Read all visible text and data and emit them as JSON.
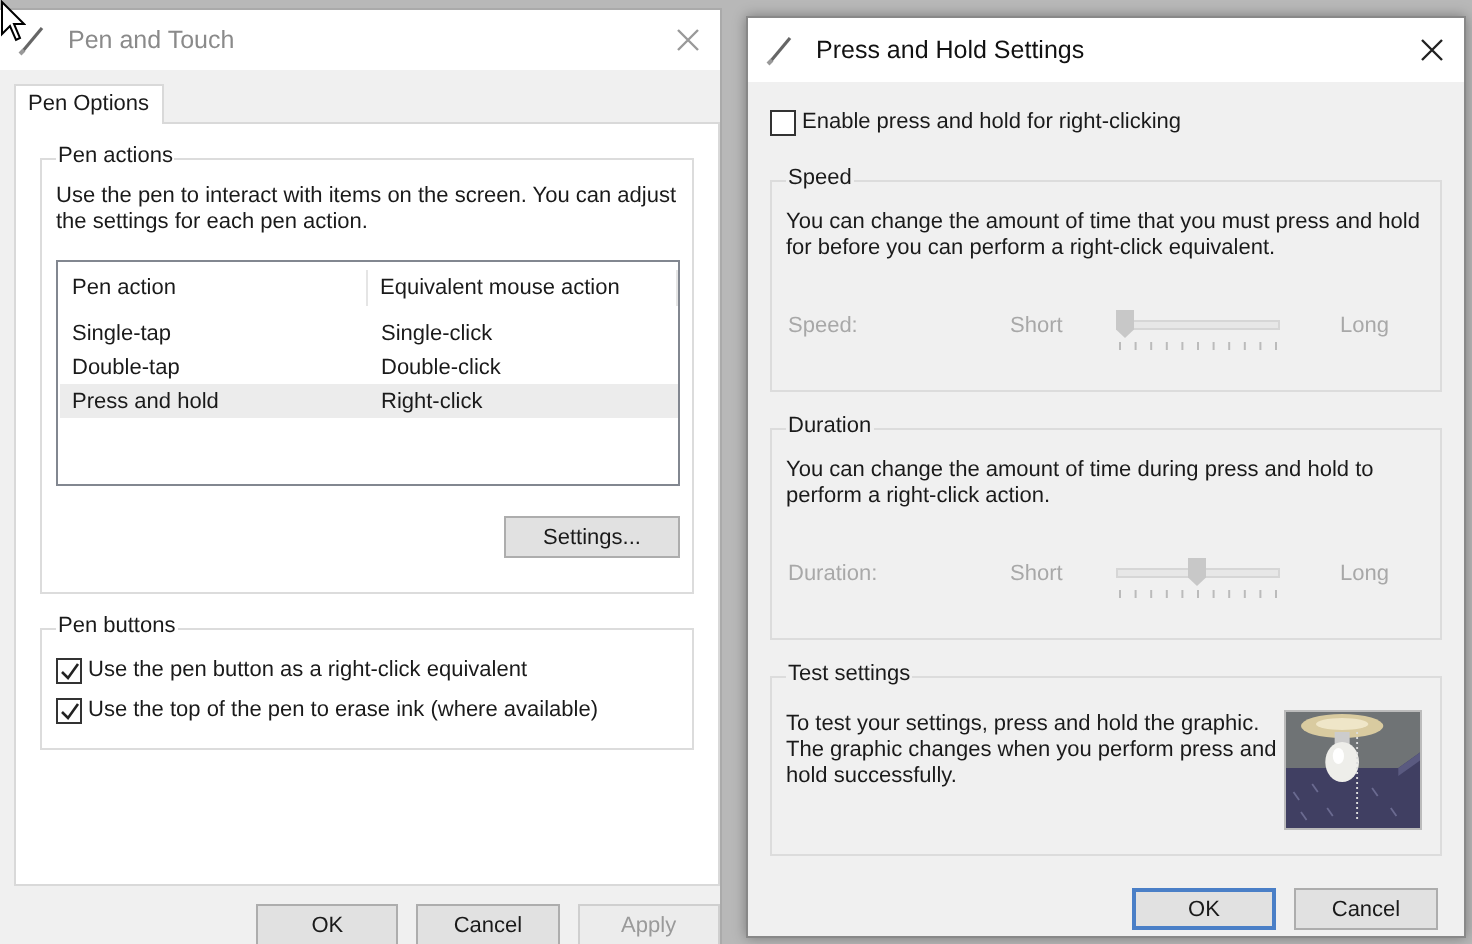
{
  "pen_and_touch": {
    "title": "Pen and Touch",
    "active": false,
    "tabs": [
      {
        "label": "Pen Options",
        "selected": true
      }
    ],
    "pen_actions": {
      "title": "Pen actions",
      "description": "Use the pen to interact with items on the screen. You can adjust the settings for each pen action.",
      "table": {
        "columns": [
          "Pen action",
          "Equivalent mouse action"
        ],
        "rows": [
          {
            "cells": [
              "Single-tap",
              "Single-click"
            ],
            "selected": false
          },
          {
            "cells": [
              "Double-tap",
              "Double-click"
            ],
            "selected": false
          },
          {
            "cells": [
              "Press and hold",
              "Right-click"
            ],
            "selected": true
          }
        ]
      },
      "button": "Settings..."
    },
    "pen_buttons": {
      "title": "Pen buttons",
      "options": [
        {
          "label": "Use the pen button as a right-click equivalent",
          "checked": true
        },
        {
          "label": "Use the top of the pen to erase ink (where available)",
          "checked": true
        }
      ]
    },
    "buttons": [
      {
        "label": "OK",
        "disabled": false
      },
      {
        "label": "Cancel",
        "disabled": false
      },
      {
        "label": "Apply",
        "disabled": true
      }
    ]
  },
  "press_and_hold": {
    "title": "Press and Hold Settings",
    "active": true,
    "enable": {
      "label": "Enable press and hold for right-clicking",
      "checked": false
    },
    "groups": [
      {
        "kind": "slider",
        "title": "Speed",
        "description": "You can change the amount of time that you must press and hold for before you can perform a right-click equivalent.",
        "slider": {
          "label": "Speed:",
          "min_label": "Short",
          "max_label": "Long",
          "level": 0,
          "disabled": true
        }
      },
      {
        "kind": "slider",
        "title": "Duration",
        "description": "You can change the amount of time during press and hold to perform a right-click action.",
        "slider": {
          "label": "Duration:",
          "min_label": "Short",
          "max_label": "Long",
          "level": 0.45,
          "disabled": true
        }
      },
      {
        "kind": "test",
        "title": "Test settings",
        "description": "To test your settings, press and hold the graphic. The graphic changes when you perform press and hold successfully."
      }
    ],
    "buttons": [
      {
        "label": "OK",
        "default": true
      },
      {
        "label": "Cancel",
        "default": false
      }
    ]
  }
}
